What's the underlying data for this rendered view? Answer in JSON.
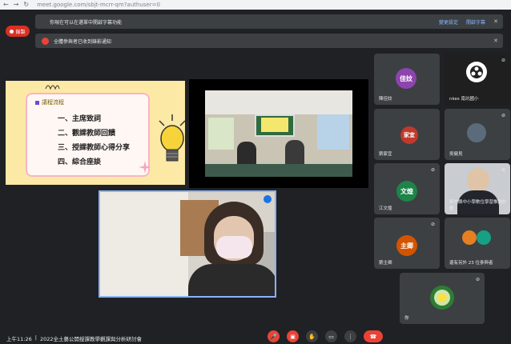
{
  "browser": {
    "url": "meet.google.com/sbjt-mcrr-qm?authuser=0"
  },
  "notices": {
    "captions_notice": "你現在可以在選單中開啟字幕功能",
    "caption_links": [
      "變更設定",
      "開啟字幕"
    ],
    "recording_notice": "全體參與者已收到錄影通知"
  },
  "recording_label": "錄製",
  "slide": {
    "heading": "議程流程",
    "agenda": [
      "一、主席致詞",
      "二、觀課教師回饋",
      "三、授課教師心得分享",
      "四、綜合座談"
    ]
  },
  "participants": [
    {
      "avatar_text": "佳妏",
      "name": "陳佳妏",
      "color": "#8e44ad"
    },
    {
      "avatar_text": "",
      "name": "nkes 南坑國小",
      "color": "#1f1f1f"
    },
    {
      "avatar_text": "家宜",
      "name": "劉家宜",
      "color": "#c0392b"
    },
    {
      "avatar_text": "",
      "name": "吳健見",
      "color": "#5b6b7b"
    },
    {
      "avatar_text": "文煌",
      "name": "江文煌",
      "color": "#1e8449"
    },
    {
      "avatar_text": "",
      "name": "新竹縣中小學數位學習推動計畫",
      "color": "#7a8899"
    },
    {
      "avatar_text": "主卿",
      "name": "劉主卿",
      "color": "#d35400"
    },
    {
      "avatar_text": "其他 23 位參與者",
      "name": "還有另外 23 位參與者",
      "color": "#3c4043"
    },
    {
      "avatar_text": "",
      "name": "你",
      "color": "#2e7d32"
    }
  ],
  "bottom": {
    "time": "上午11:26",
    "separator": "|",
    "meeting_title": "2022全土藝公開授課教學觀課與分析研討會"
  },
  "controls": [
    "mic-off",
    "camera-off",
    "raise-hand",
    "present",
    "more",
    "hang-up"
  ]
}
